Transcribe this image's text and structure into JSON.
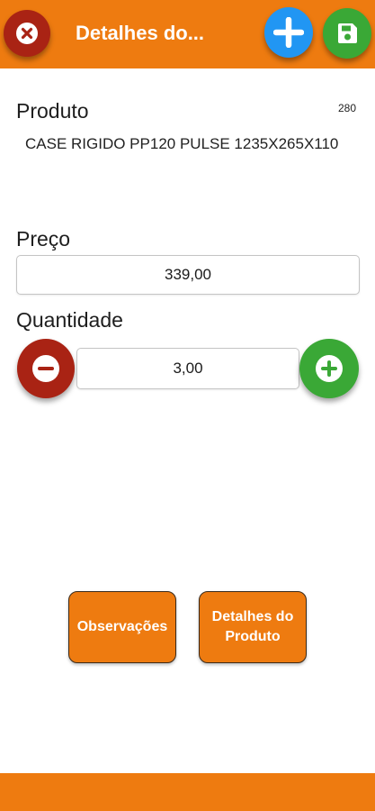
{
  "header": {
    "title": "Detalhes do...",
    "close_icon": "close-icon",
    "add_icon": "plus-icon",
    "save_icon": "save-icon",
    "bar_color": "#ee7b10"
  },
  "produto": {
    "label": "Produto",
    "code": "280",
    "name": "CASE RIGIDO PP120 PULSE 1235X265X110"
  },
  "preco": {
    "label": "Preço",
    "value": "339,00"
  },
  "quantidade": {
    "label": "Quantidade",
    "value": "3,00",
    "decrement_icon": "minus-icon",
    "increment_icon": "plus-icon"
  },
  "actions": {
    "observacoes_label": "Observações",
    "detalhes_label": "Detalhes do Produto"
  },
  "colors": {
    "accent": "#ee7b10",
    "danger": "#a92314",
    "info": "#2196f3",
    "success": "#3aa836"
  }
}
